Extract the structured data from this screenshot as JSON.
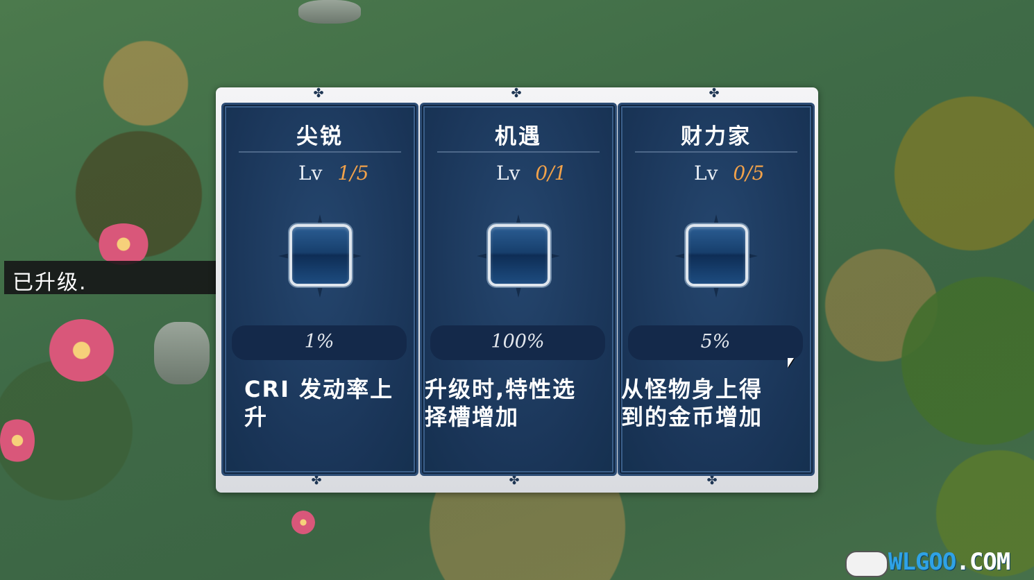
{
  "toast": {
    "message": "已升级."
  },
  "cards": [
    {
      "title": "尖锐",
      "lv_label": "Lv",
      "level": "1/5",
      "value": "1%",
      "description_line1": "CRI 发动率上",
      "description_line2": "升"
    },
    {
      "title": "机遇",
      "lv_label": "Lv",
      "level": "0/1",
      "value": "100%",
      "description_line1": "升级时,特性选",
      "description_line2": "择槽增加"
    },
    {
      "title": "财力家",
      "lv_label": "Lv",
      "level": "0/5",
      "value": "5%",
      "description_line1": "从怪物身上得",
      "description_line2": "到的金币增加"
    }
  ],
  "watermark": {
    "brand": "WLGOO",
    "suffix": ".COM",
    "icon": "gamepad-icon"
  },
  "colors": {
    "card_bg": "#1a3558",
    "level_accent": "#f2a24a",
    "panel_frame": "#eceef2",
    "logo": "#2fa2e6"
  }
}
